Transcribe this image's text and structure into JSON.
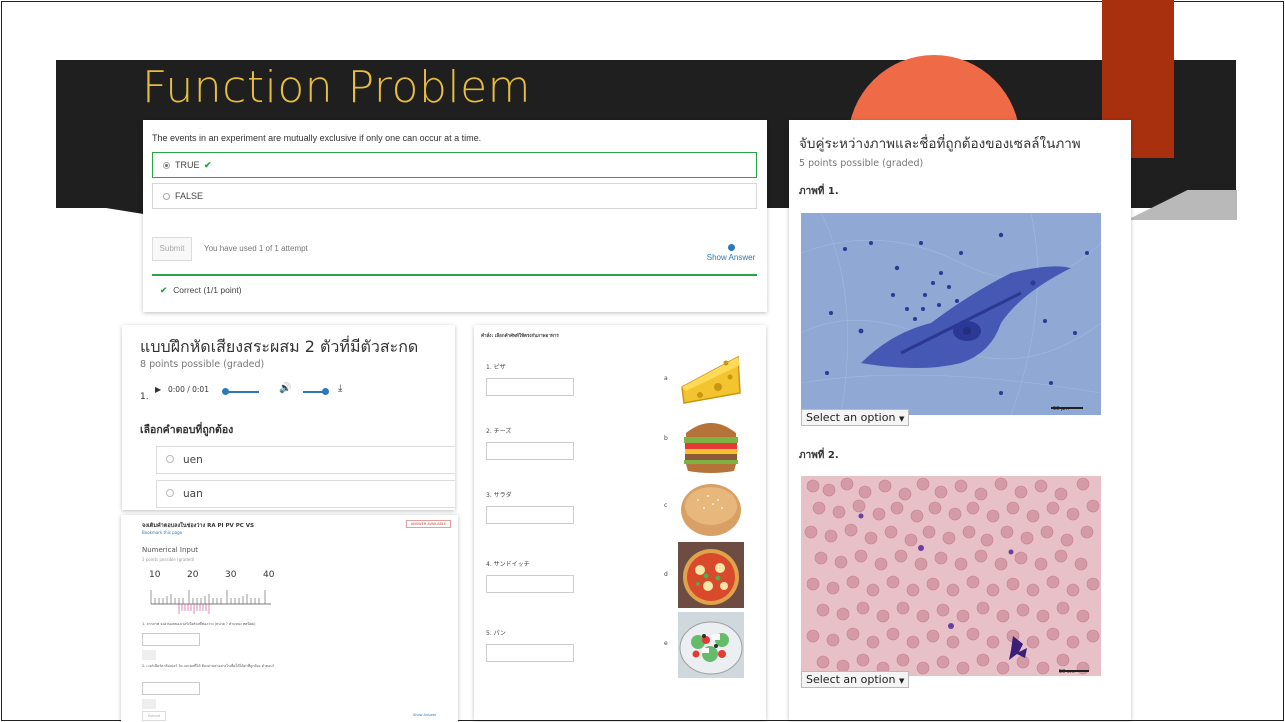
{
  "slide": {
    "title": "Function Problem"
  },
  "truefalse": {
    "question": "The events in an experiment are mutually exclusive if only one can occur at a time.",
    "options": [
      {
        "label": "TRUE",
        "selected": true,
        "correct": true
      },
      {
        "label": "FALSE",
        "selected": false,
        "correct": false
      }
    ],
    "submit_label": "Submit",
    "attempts_text": "You have used 1 of 1 attempt",
    "show_answer_label": "Show Answer",
    "result_text": "Correct (1/1 point)"
  },
  "pronunciation": {
    "title": "แบบฝึกหัดเสียงสระผสม 2 ตัวที่มีตัวสะกด",
    "points": "8 points possible (graded)",
    "question_number": "1.",
    "audio_time": "0:00 / 0:01",
    "prompt": "เลือกคำตอบที่ถูกต้อง",
    "choices": [
      "uen",
      "uan"
    ]
  },
  "numerical": {
    "title": "จงเติมคำตอบลงในช่องว่าง RA PI PV PC VS",
    "bookmark_label": "Bookmark this page",
    "badge": "ANSWER AVAILABLE",
    "subtitle": "Numerical Input",
    "points": "2 points possible (graded)",
    "ruler_labels": [
      "10",
      "20",
      "30",
      "40"
    ],
    "question1": "1. จากภาพ จงอ่านผลของเวอร์เนียร์ลงที่ช่องว่าง (หน่วย ? ตำแหน่ง ทศนิยม)",
    "question2": "2. เวอร์เนียร์คาลิปเปอร์ วัด และผลที่ได้ ต้องอ่านค่าอย่างไรเพื่อให้ได้ค่าที่ถูกต้อง คำตอบ?",
    "submit_label": "Submit",
    "show_answer_label": "Show Answer"
  },
  "matching_food": {
    "instruction": "คำสั่ง: เลือกคำศัพท์ให้ตรงกับภาพอาหาร",
    "items": [
      {
        "label": "1. ピザ",
        "letter": "a",
        "icon": "cheese-icon"
      },
      {
        "label": "2. チーズ",
        "letter": "b",
        "icon": "sandwich-icon"
      },
      {
        "label": "3. サラダ",
        "letter": "c",
        "icon": "bread-icon"
      },
      {
        "label": "4. サンドイッチ",
        "letter": "d",
        "icon": "pizza-icon"
      },
      {
        "label": "5. パン",
        "letter": "e",
        "icon": "salad-icon"
      }
    ]
  },
  "cells": {
    "title": "จับคู่ระหว่างภาพและชื่อที่ถูกต้องของเซลล์ในภาพ",
    "points": "5 points possible (graded)",
    "figures": [
      {
        "label": "ภาพที่ 1.",
        "select": "Select an option",
        "scale": "50 µm"
      },
      {
        "label": "ภาพที่ 2.",
        "select": "Select an option",
        "scale": "50 cm"
      }
    ]
  },
  "colors": {
    "title": "#e7bd3c",
    "banner": "#1f1f1f",
    "accent_orange": "#ef6a47",
    "accent_red": "#a8300f",
    "correct_green": "#2aa345",
    "link_blue": "#2d79b8"
  }
}
